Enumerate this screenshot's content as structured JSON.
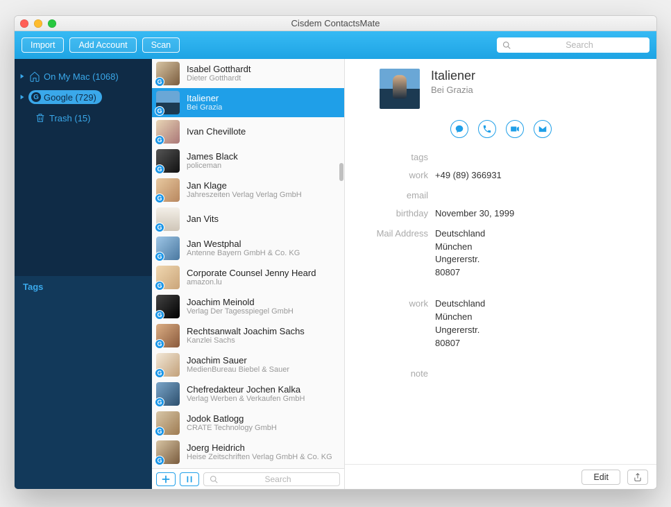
{
  "window": {
    "title": "Cisdem ContactsMate"
  },
  "toolbar": {
    "import": "Import",
    "addAccount": "Add Account",
    "scan": "Scan",
    "searchPlaceholder": "Search"
  },
  "sidebar": {
    "onMyMac": "On My Mac (1068)",
    "google": "Google (729)",
    "trash": "Trash (15)",
    "tags": "Tags"
  },
  "contacts": [
    {
      "name": "Isabel Gotthardt",
      "sub": "Dieter Gotthardt",
      "av": "av1"
    },
    {
      "name": "Italiener",
      "sub": "Bei Grazia",
      "av": "av2",
      "selected": true
    },
    {
      "name": "Ivan Chevillote",
      "sub": "",
      "av": "av3"
    },
    {
      "name": "James Black",
      "sub": "policeman",
      "av": "av4"
    },
    {
      "name": "Jan Klage",
      "sub": "Jahreszeiten Verlag Verlag GmbH",
      "av": "av5"
    },
    {
      "name": "Jan Vits",
      "sub": "",
      "av": "av6"
    },
    {
      "name": "Jan Westphal",
      "sub": "Antenne Bayern GmbH & Co. KG",
      "av": "av7"
    },
    {
      "name": "Corporate Counsel Jenny Heard",
      "sub": "amazon.lu",
      "av": "av8"
    },
    {
      "name": "Joachim Meinold",
      "sub": "Verlag Der Tagesspiegel GmbH",
      "av": "av9"
    },
    {
      "name": "Rechtsanwalt Joachim Sachs",
      "sub": "Kanzlei Sachs",
      "av": "av10"
    },
    {
      "name": "Joachim Sauer",
      "sub": "MedienBureau Biebel & Sauer",
      "av": "av11"
    },
    {
      "name": "Chefredakteur Jochen Kalka",
      "sub": "Verlag Werben & Verkaufen GmbH",
      "av": "av12"
    },
    {
      "name": "Jodok Batlogg",
      "sub": "CRATE Technology GmbH",
      "av": "av13"
    },
    {
      "name": "Joerg Heidrich",
      "sub": "Heise Zeitschriften Verlag GmbH & Co. KG",
      "av": "av1"
    }
  ],
  "listFooter": {
    "searchPlaceholder": "Search"
  },
  "detail": {
    "name": "Italiener",
    "company": "Bei Grazia",
    "fields": {
      "tagsLabel": "tags",
      "workPhoneLabel": "work",
      "workPhone": "+49 (89) 366931",
      "emailLabel": "email",
      "birthdayLabel": "birthday",
      "birthday": "November 30, 1999",
      "mailAddrLabel": "Mail Address",
      "mailAddr": "Deutschland\nMünchen\nUngererstr.\n80807",
      "workAddrLabel": "work",
      "workAddr": "Deutschland\nMünchen\nUngererstr.\n80807",
      "noteLabel": "note"
    },
    "editLabel": "Edit"
  }
}
